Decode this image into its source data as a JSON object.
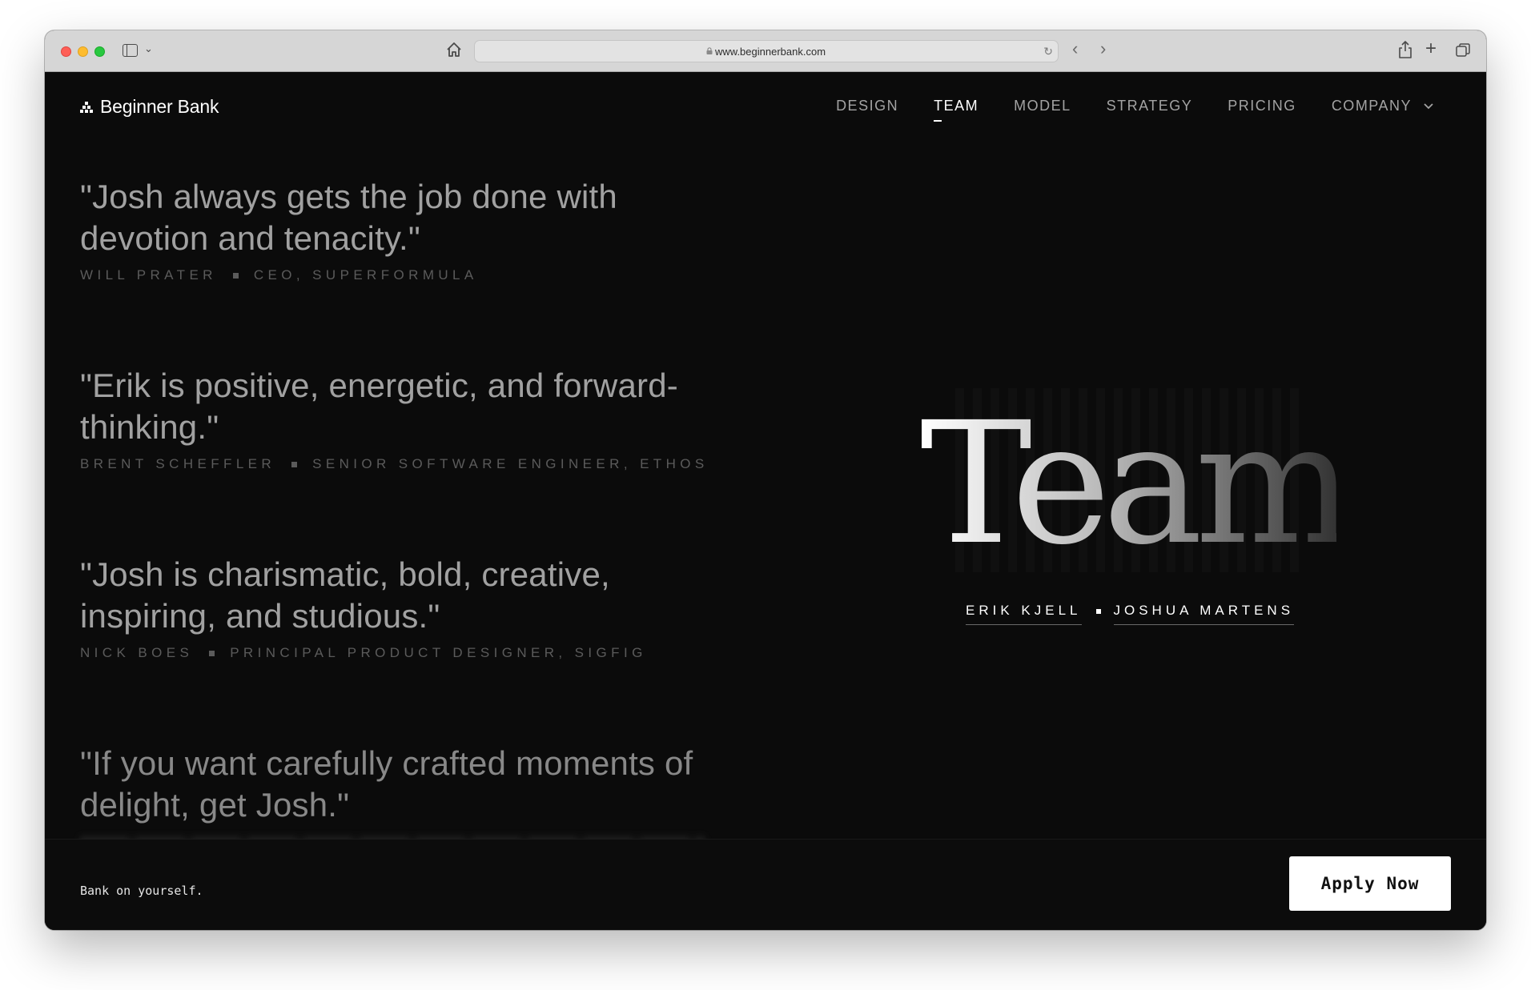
{
  "browser": {
    "url": "www.beginnerbank.com"
  },
  "site": {
    "brand": "Beginner Bank",
    "nav": [
      {
        "label": "DESIGN",
        "active": false
      },
      {
        "label": "TEAM",
        "active": true
      },
      {
        "label": "MODEL",
        "active": false
      },
      {
        "label": "STRATEGY",
        "active": false
      },
      {
        "label": "PRICING",
        "active": false
      },
      {
        "label": "COMPANY",
        "active": false,
        "dropdown": true
      }
    ]
  },
  "testimonials": [
    {
      "quote": "\"Josh always gets the job done with devotion and tenacity.\"",
      "name": "WILL PRATER",
      "role": "CEO, SUPERFORMULA"
    },
    {
      "quote": "\"Erik is positive, energetic, and forward-thinking.\"",
      "name": "BRENT SCHEFFLER",
      "role": "SENIOR SOFTWARE ENGINEER, ETHOS"
    },
    {
      "quote": "\"Josh is charismatic, bold, creative, inspiring, and studious.\"",
      "name": "NICK BOES",
      "role": "PRINCIPAL PRODUCT DESIGNER, SIGFIG"
    },
    {
      "quote": "\"If you want carefully crafted moments of delight, get Josh.\""
    }
  ],
  "team": {
    "title": "Team",
    "members": [
      "ERIK KJELL",
      "JOSHUA MARTENS"
    ]
  },
  "footer": {
    "tagline": "Bank on yourself.",
    "cta": "Apply Now"
  }
}
